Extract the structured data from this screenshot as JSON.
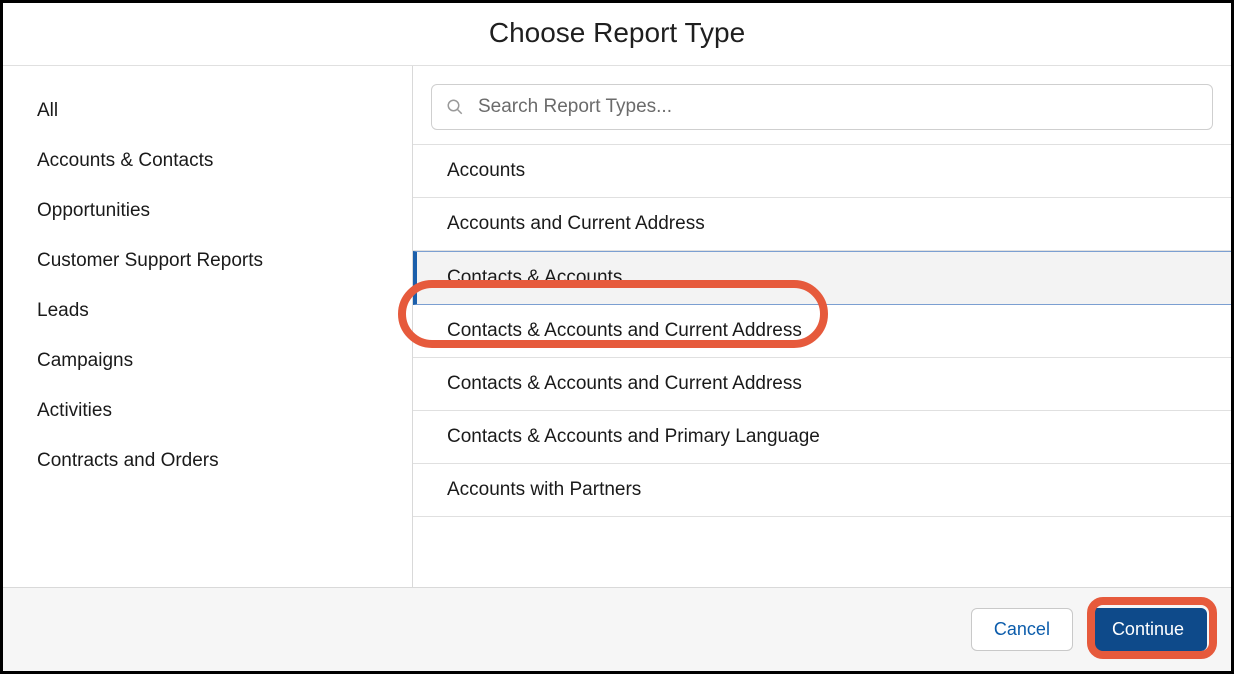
{
  "header": {
    "title": "Choose Report Type"
  },
  "search": {
    "placeholder": "Search Report Types...",
    "value": ""
  },
  "sidebar": {
    "items": [
      {
        "label": "All"
      },
      {
        "label": "Accounts & Contacts"
      },
      {
        "label": "Opportunities"
      },
      {
        "label": "Customer Support Reports"
      },
      {
        "label": "Leads"
      },
      {
        "label": "Campaigns"
      },
      {
        "label": "Activities"
      },
      {
        "label": "Contracts and Orders"
      }
    ]
  },
  "report_types": [
    {
      "label": "Accounts",
      "selected": false
    },
    {
      "label": "Accounts and Current Address",
      "selected": false
    },
    {
      "label": "Contacts & Accounts",
      "selected": true
    },
    {
      "label": "Contacts & Accounts and Current Address",
      "selected": false
    },
    {
      "label": "Contacts & Accounts and Current Address",
      "selected": false
    },
    {
      "label": "Contacts & Accounts and Primary Language",
      "selected": false
    },
    {
      "label": "Accounts with Partners",
      "selected": false
    }
  ],
  "footer": {
    "cancel_label": "Cancel",
    "continue_label": "Continue"
  }
}
